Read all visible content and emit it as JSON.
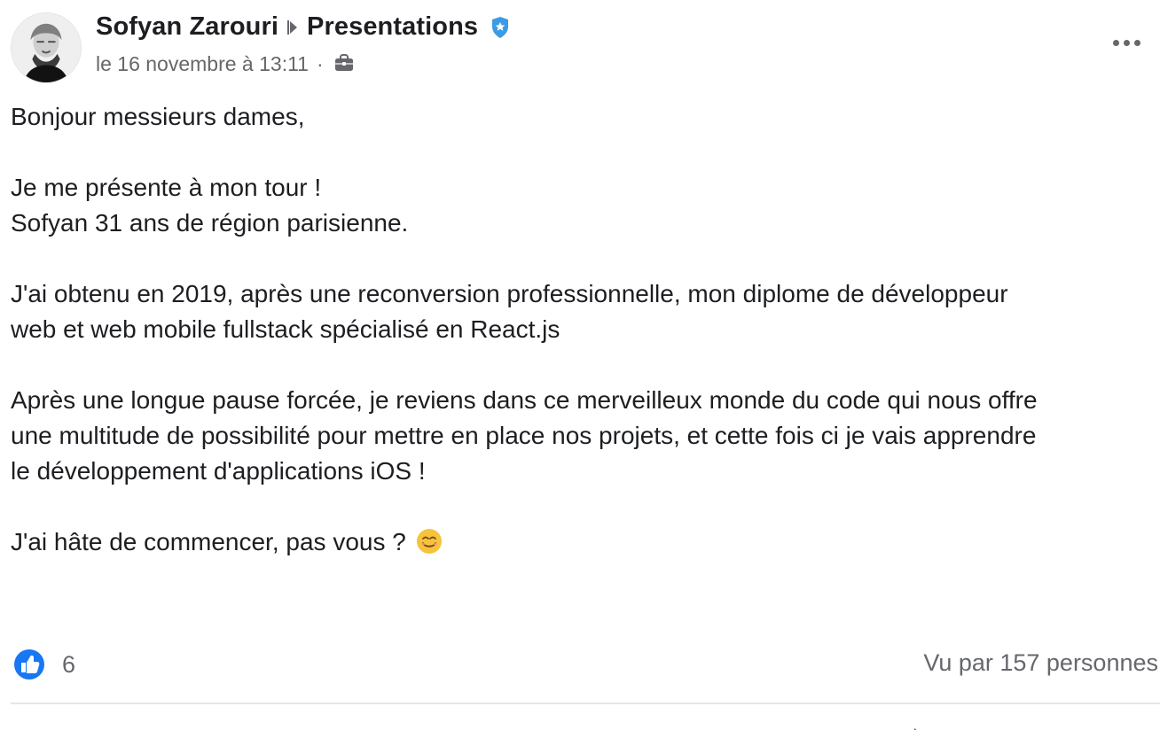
{
  "post": {
    "author": "Sofyan Zarouri",
    "group": "Presentations",
    "timestamp": "le 16 novembre à 13:11",
    "meta_separator": "·",
    "icons": {
      "avatar": "profile-avatar",
      "arrow": "breadcrumb-arrow-icon",
      "badge": "verified-badge-icon",
      "audience": "briefcase-icon",
      "more": "more-options-icon",
      "like": "like-icon",
      "emoji": "smiling-face-icon"
    },
    "colors": {
      "text": "#1c1e21",
      "secondary_text": "#65676b",
      "badge": "#3b9be5",
      "like": "#1877f2",
      "emoji": "#f7c33d"
    },
    "paragraphs": [
      [
        "Bonjour messieurs dames,"
      ],
      [
        "Je me présente à mon tour !",
        "Sofyan 31 ans de région parisienne."
      ],
      [
        "J'ai obtenu en 2019, après une reconversion professionnelle, mon diplome de développeur",
        "web et web mobile fullstack spécialisé en React.js"
      ],
      [
        "Après une longue pause forcée, je reviens dans ce merveilleux monde du code qui nous offre",
        "une multitude de possibilité pour mettre en place nos projets, et cette fois ci je vais apprendre",
        "le développement d'applications iOS !"
      ],
      [
        "J'ai hâte de commencer, pas vous ?"
      ]
    ],
    "reactions_count": "6",
    "seen_by": "Vu par 157 personnes"
  }
}
